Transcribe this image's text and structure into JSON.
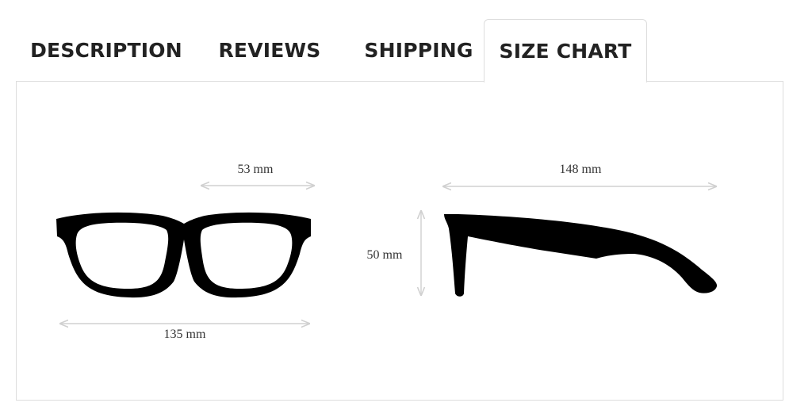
{
  "tabs": [
    {
      "label": "DESCRIPTION",
      "active": false
    },
    {
      "label": "REVIEWS",
      "active": false
    },
    {
      "label": "SHIPPING",
      "active": false
    },
    {
      "label": "SIZE CHART",
      "active": true
    }
  ],
  "size_chart": {
    "lens_width": "53 mm",
    "frame_width": "135 mm",
    "lens_height": "50 mm",
    "temple_length": "148 mm"
  },
  "colors": {
    "frame": "#000000",
    "dimension_line": "#d0d0d0",
    "tab_text": "#222222",
    "border": "#dddddd"
  }
}
